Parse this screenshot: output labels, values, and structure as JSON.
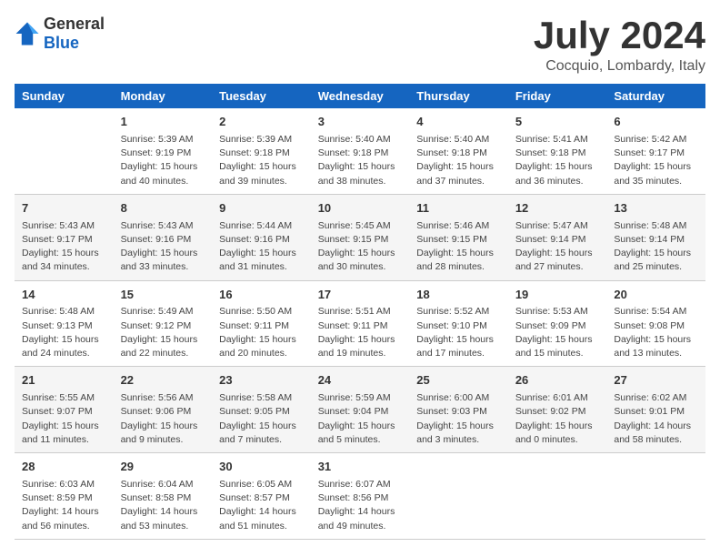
{
  "logo": {
    "general": "General",
    "blue": "Blue"
  },
  "title": "July 2024",
  "subtitle": "Cocquio, Lombardy, Italy",
  "headers": [
    "Sunday",
    "Monday",
    "Tuesday",
    "Wednesday",
    "Thursday",
    "Friday",
    "Saturday"
  ],
  "weeks": [
    [
      {
        "day": "",
        "info": ""
      },
      {
        "day": "1",
        "info": "Sunrise: 5:39 AM\nSunset: 9:19 PM\nDaylight: 15 hours\nand 40 minutes."
      },
      {
        "day": "2",
        "info": "Sunrise: 5:39 AM\nSunset: 9:18 PM\nDaylight: 15 hours\nand 39 minutes."
      },
      {
        "day": "3",
        "info": "Sunrise: 5:40 AM\nSunset: 9:18 PM\nDaylight: 15 hours\nand 38 minutes."
      },
      {
        "day": "4",
        "info": "Sunrise: 5:40 AM\nSunset: 9:18 PM\nDaylight: 15 hours\nand 37 minutes."
      },
      {
        "day": "5",
        "info": "Sunrise: 5:41 AM\nSunset: 9:18 PM\nDaylight: 15 hours\nand 36 minutes."
      },
      {
        "day": "6",
        "info": "Sunrise: 5:42 AM\nSunset: 9:17 PM\nDaylight: 15 hours\nand 35 minutes."
      }
    ],
    [
      {
        "day": "7",
        "info": "Sunrise: 5:43 AM\nSunset: 9:17 PM\nDaylight: 15 hours\nand 34 minutes."
      },
      {
        "day": "8",
        "info": "Sunrise: 5:43 AM\nSunset: 9:16 PM\nDaylight: 15 hours\nand 33 minutes."
      },
      {
        "day": "9",
        "info": "Sunrise: 5:44 AM\nSunset: 9:16 PM\nDaylight: 15 hours\nand 31 minutes."
      },
      {
        "day": "10",
        "info": "Sunrise: 5:45 AM\nSunset: 9:15 PM\nDaylight: 15 hours\nand 30 minutes."
      },
      {
        "day": "11",
        "info": "Sunrise: 5:46 AM\nSunset: 9:15 PM\nDaylight: 15 hours\nand 28 minutes."
      },
      {
        "day": "12",
        "info": "Sunrise: 5:47 AM\nSunset: 9:14 PM\nDaylight: 15 hours\nand 27 minutes."
      },
      {
        "day": "13",
        "info": "Sunrise: 5:48 AM\nSunset: 9:14 PM\nDaylight: 15 hours\nand 25 minutes."
      }
    ],
    [
      {
        "day": "14",
        "info": "Sunrise: 5:48 AM\nSunset: 9:13 PM\nDaylight: 15 hours\nand 24 minutes."
      },
      {
        "day": "15",
        "info": "Sunrise: 5:49 AM\nSunset: 9:12 PM\nDaylight: 15 hours\nand 22 minutes."
      },
      {
        "day": "16",
        "info": "Sunrise: 5:50 AM\nSunset: 9:11 PM\nDaylight: 15 hours\nand 20 minutes."
      },
      {
        "day": "17",
        "info": "Sunrise: 5:51 AM\nSunset: 9:11 PM\nDaylight: 15 hours\nand 19 minutes."
      },
      {
        "day": "18",
        "info": "Sunrise: 5:52 AM\nSunset: 9:10 PM\nDaylight: 15 hours\nand 17 minutes."
      },
      {
        "day": "19",
        "info": "Sunrise: 5:53 AM\nSunset: 9:09 PM\nDaylight: 15 hours\nand 15 minutes."
      },
      {
        "day": "20",
        "info": "Sunrise: 5:54 AM\nSunset: 9:08 PM\nDaylight: 15 hours\nand 13 minutes."
      }
    ],
    [
      {
        "day": "21",
        "info": "Sunrise: 5:55 AM\nSunset: 9:07 PM\nDaylight: 15 hours\nand 11 minutes."
      },
      {
        "day": "22",
        "info": "Sunrise: 5:56 AM\nSunset: 9:06 PM\nDaylight: 15 hours\nand 9 minutes."
      },
      {
        "day": "23",
        "info": "Sunrise: 5:58 AM\nSunset: 9:05 PM\nDaylight: 15 hours\nand 7 minutes."
      },
      {
        "day": "24",
        "info": "Sunrise: 5:59 AM\nSunset: 9:04 PM\nDaylight: 15 hours\nand 5 minutes."
      },
      {
        "day": "25",
        "info": "Sunrise: 6:00 AM\nSunset: 9:03 PM\nDaylight: 15 hours\nand 3 minutes."
      },
      {
        "day": "26",
        "info": "Sunrise: 6:01 AM\nSunset: 9:02 PM\nDaylight: 15 hours\nand 0 minutes."
      },
      {
        "day": "27",
        "info": "Sunrise: 6:02 AM\nSunset: 9:01 PM\nDaylight: 14 hours\nand 58 minutes."
      }
    ],
    [
      {
        "day": "28",
        "info": "Sunrise: 6:03 AM\nSunset: 8:59 PM\nDaylight: 14 hours\nand 56 minutes."
      },
      {
        "day": "29",
        "info": "Sunrise: 6:04 AM\nSunset: 8:58 PM\nDaylight: 14 hours\nand 53 minutes."
      },
      {
        "day": "30",
        "info": "Sunrise: 6:05 AM\nSunset: 8:57 PM\nDaylight: 14 hours\nand 51 minutes."
      },
      {
        "day": "31",
        "info": "Sunrise: 6:07 AM\nSunset: 8:56 PM\nDaylight: 14 hours\nand 49 minutes."
      },
      {
        "day": "",
        "info": ""
      },
      {
        "day": "",
        "info": ""
      },
      {
        "day": "",
        "info": ""
      }
    ]
  ]
}
